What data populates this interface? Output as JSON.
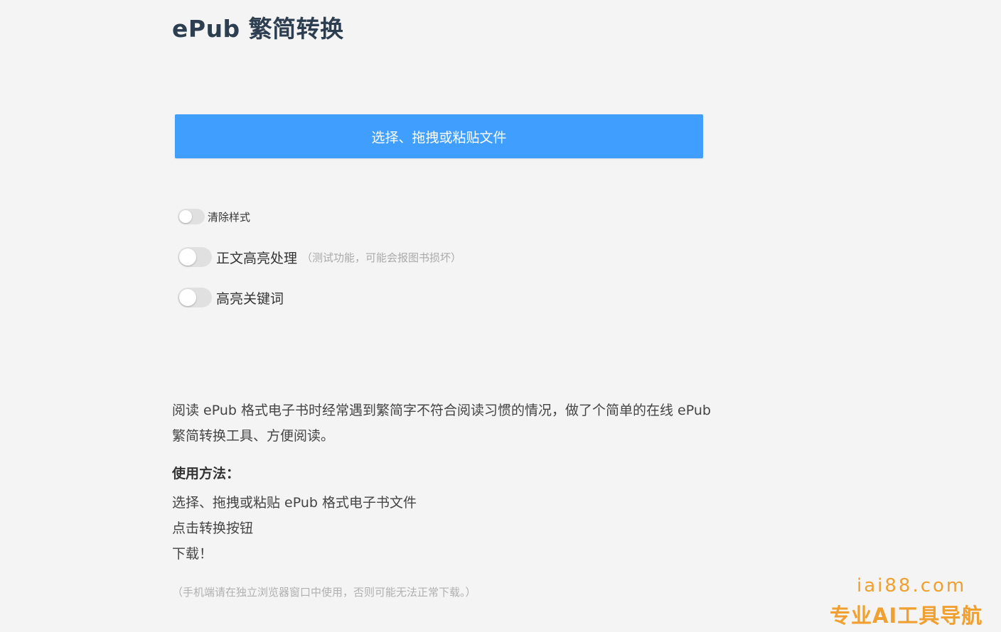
{
  "header": {
    "title": "ePub 繁简转换"
  },
  "upload": {
    "button_label": "选择、拖拽或粘贴文件"
  },
  "options": [
    {
      "label": "清除样式",
      "note": "",
      "checked": false
    },
    {
      "label": "正文高亮处理",
      "note": "（测试功能，可能会报图书损坏）",
      "checked": false
    },
    {
      "label": "高亮关键词",
      "note": "",
      "checked": false
    }
  ],
  "description": {
    "text": "阅读 ePub 格式电子书时经常遇到繁简字不符合阅读习惯的情况，做了个简单的在线 ePub 繁简转换工具、方便阅读。"
  },
  "usage": {
    "title": "使用方法：",
    "steps": [
      "选择、拖拽或粘贴 ePub 格式电子书文件",
      "点击转换按钮",
      "下载！"
    ]
  },
  "footnote": "（手机端请在独立浏览器窗口中使用，否则可能无法正常下载。）",
  "watermark": {
    "url": "iai88.com",
    "tagline": "专业AI工具导航"
  },
  "colors": {
    "accent": "#409eff",
    "watermark": "#f0a030",
    "background": "#f4f4f4"
  }
}
